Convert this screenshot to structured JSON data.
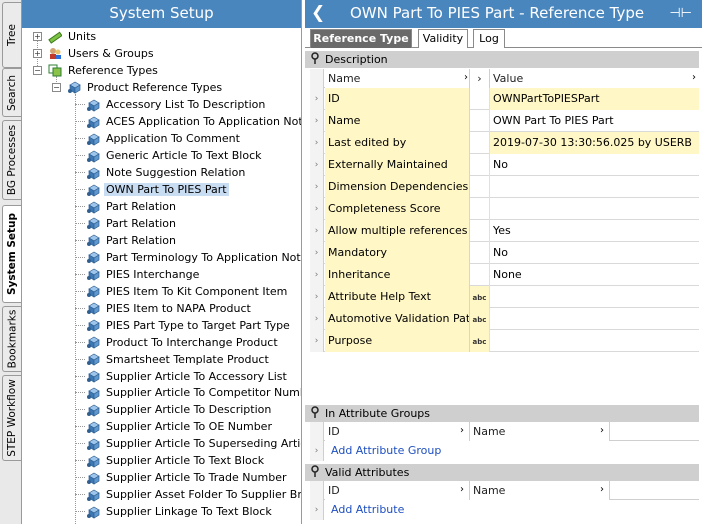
{
  "side_tabs": [
    {
      "label": "Tree"
    },
    {
      "label": "Search"
    },
    {
      "label": "BG Processes"
    },
    {
      "label": "System Setup"
    },
    {
      "label": "Bookmarks"
    },
    {
      "label": "STEP Workflow"
    }
  ],
  "left": {
    "title": "System Setup",
    "tree": [
      {
        "label": "Units",
        "level": 0,
        "exp": "+",
        "icon": "ruler-icon"
      },
      {
        "label": "Users & Groups",
        "level": 0,
        "exp": "+",
        "icon": "users-icon"
      },
      {
        "label": "Reference Types",
        "level": 0,
        "exp": "-",
        "icon": "reference-types-icon"
      },
      {
        "label": "Product Reference Types",
        "level": 1,
        "exp": "-",
        "icon": "cube-icon"
      }
    ],
    "items": [
      "Accessory List To Description",
      "ACES Application To Application Note",
      "Application To Comment",
      "Generic Article To Text Block",
      "Note Suggestion Relation",
      "OWN Part To PIES Part",
      "Part Relation",
      "Part Relation",
      "Part Relation",
      "Part Terminology To Application Note",
      "PIES Interchange",
      "PIES Item To Kit Component Item",
      "PIES Item to NAPA Product",
      "PIES Part Type to Target Part Type",
      "Product To Interchange Product",
      "Smartsheet Template Product",
      "Supplier Article To Accessory List",
      "Supplier Article To Competitor Number",
      "Supplier Article To Description",
      "Supplier Article To OE Number",
      "Supplier Article To Superseding Article",
      "Supplier Article To Text Block",
      "Supplier Article To Trade Number",
      "Supplier Asset Folder To Supplier Brand",
      "Supplier Linkage To Text Block"
    ],
    "selected_index": 5
  },
  "right": {
    "title": "OWN Part To PIES Part - Reference Type",
    "back_glyph": "❮",
    "pin_glyph": "⊣⊢",
    "tabs": [
      {
        "label": "Reference Type"
      },
      {
        "label": "Validity"
      },
      {
        "label": "Log"
      }
    ],
    "description": {
      "header": "Description",
      "col_name": "Name",
      "col_value": "Value",
      "rows": [
        {
          "name": "ID",
          "value": "OWNPartToPIESPart",
          "yellow": true
        },
        {
          "name": "Name",
          "value": "OWN Part To PIES Part",
          "yellow": false
        },
        {
          "name": "Last edited by",
          "value": "2019-07-30 13:30:56.025 by USERB",
          "yellow": true
        },
        {
          "name": "Externally Maintained",
          "value": "No",
          "yellow": false
        },
        {
          "name": "Dimension Dependencies",
          "value": "",
          "yellow": false
        },
        {
          "name": "Completeness Score",
          "value": "",
          "yellow": false
        },
        {
          "name": "Allow multiple references",
          "value": "Yes",
          "yellow": false
        },
        {
          "name": "Mandatory",
          "value": "No",
          "yellow": false
        },
        {
          "name": "Inheritance",
          "value": "None",
          "yellow": false
        },
        {
          "name": "Attribute Help Text",
          "value": "",
          "yellow": false,
          "abc": true
        },
        {
          "name": "Automotive Validation Path",
          "value": "",
          "yellow": false,
          "abc": true
        },
        {
          "name": "Purpose",
          "value": "",
          "yellow": false,
          "abc": true
        }
      ]
    },
    "attr_groups": {
      "header": "In Attribute Groups",
      "col_id": "ID",
      "col_name": "Name",
      "add_label": "Add Attribute Group"
    },
    "valid_attrs": {
      "header": "Valid Attributes",
      "col_id": "ID",
      "col_name": "Name",
      "add_label": "Add Attribute"
    },
    "abc_label": "abc"
  }
}
